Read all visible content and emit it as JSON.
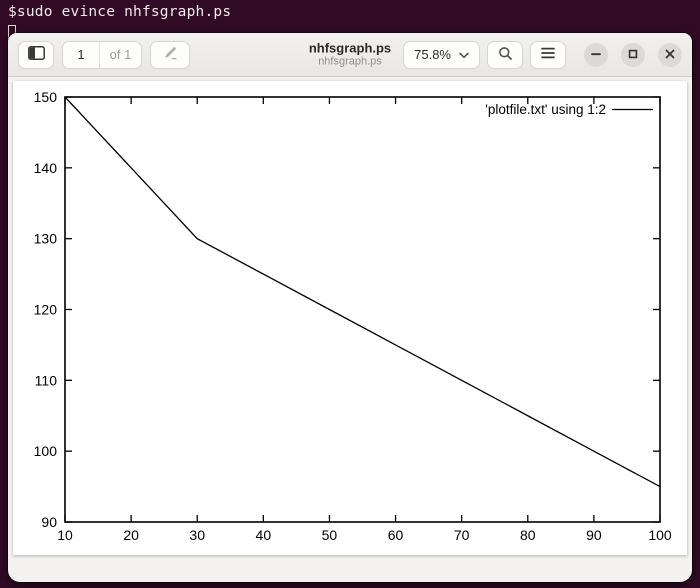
{
  "terminal": {
    "command": "$sudo evince nhfsgraph.ps"
  },
  "header": {
    "page_current": "1",
    "page_total": "of 1",
    "title": "nhfsgraph.ps",
    "subtitle": "nhfsgraph.ps",
    "zoom_level": "75.8%"
  },
  "icons": {
    "sidebar_toggle": "sidebar-panel",
    "annotate": "pen",
    "zoom_chevron": "chevron-down",
    "search": "magnifier",
    "menu": "hamburger",
    "minimize": "minus",
    "maximize": "square-outline",
    "close": "x"
  },
  "colors": {
    "terminal_bg": "#310b25",
    "terminal_text": "#efe9ed",
    "header_bg": "#eceae8",
    "doc_bg": "#f3f2f1",
    "page_bg": "#ffffff",
    "chart_line": "#000000"
  },
  "chart_data": {
    "type": "line",
    "title": "",
    "xlabel": "",
    "ylabel": "",
    "x": [
      10,
      20,
      30,
      40,
      50,
      60,
      70,
      80,
      90,
      100
    ],
    "series": [
      {
        "name": "'plotfile.txt' using 1:2",
        "values": [
          150,
          140,
          130,
          125,
          120,
          115,
          110,
          105,
          100,
          95
        ]
      }
    ],
    "xlim": [
      10,
      100
    ],
    "ylim": [
      90,
      150
    ],
    "xticks": [
      10,
      20,
      30,
      40,
      50,
      60,
      70,
      80,
      90,
      100
    ],
    "yticks": [
      90,
      100,
      110,
      120,
      130,
      140,
      150
    ],
    "grid": false,
    "legend_position": "top-right-inside",
    "tick_style": "inward-mirrored"
  }
}
